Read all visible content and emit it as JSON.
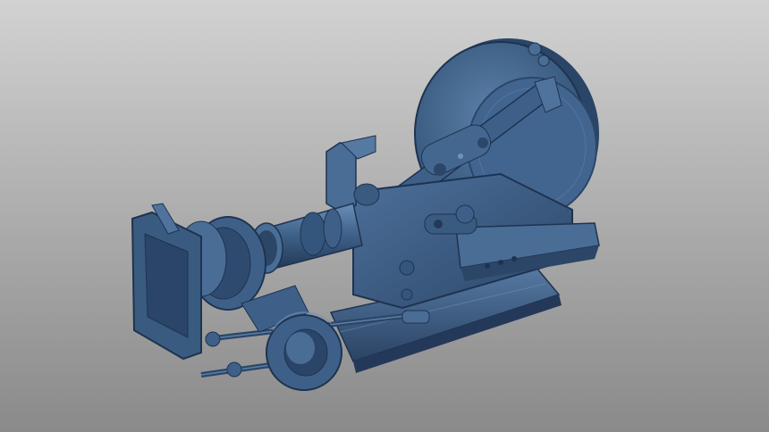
{
  "viewport": {
    "background_top": "#d2d2d2",
    "background_bottom": "#8a8a8a"
  },
  "model": {
    "subject": "camera-3d-scan",
    "color": "#3d5f85",
    "shadow_color": "#1e3350",
    "highlight_color": "#6e93ba"
  }
}
